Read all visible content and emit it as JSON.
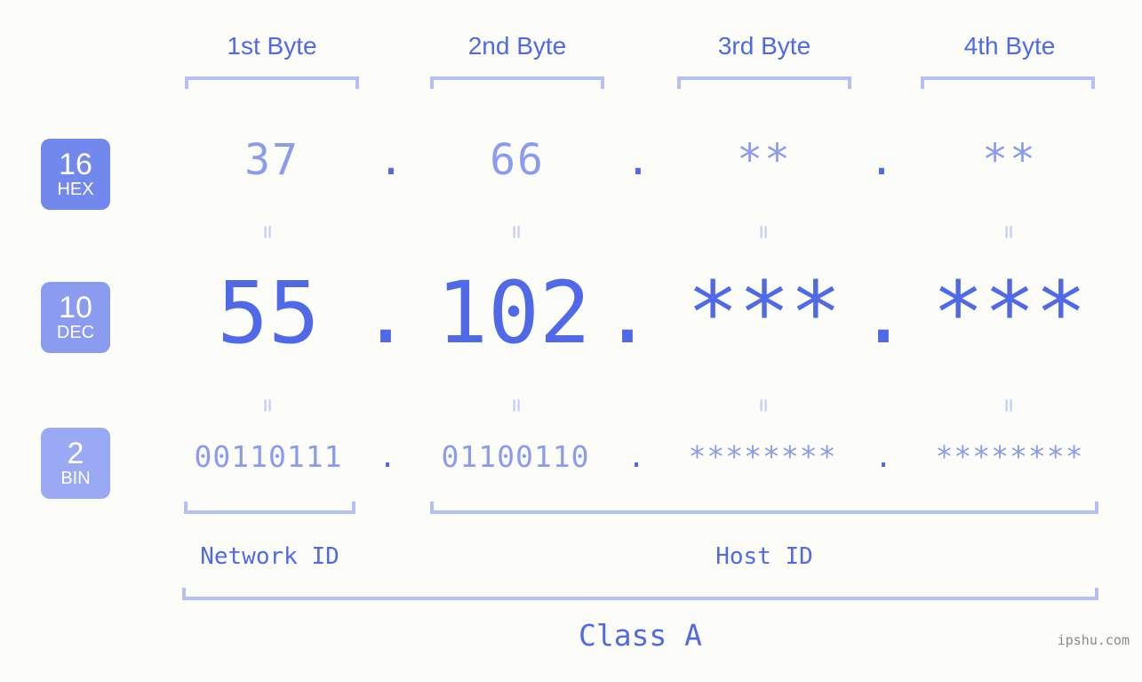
{
  "watermark": "ipshu.com",
  "byte_headers": [
    {
      "label": "1st Byte"
    },
    {
      "label": "2nd Byte"
    },
    {
      "label": "3rd Byte"
    },
    {
      "label": "4th Byte"
    }
  ],
  "bases": [
    {
      "number": "16",
      "name": "HEX",
      "color": "#7388ec"
    },
    {
      "number": "10",
      "name": "DEC",
      "color": "#8b9cf0"
    },
    {
      "number": "2",
      "name": "BIN",
      "color": "#9aa9f4"
    }
  ],
  "rows": {
    "hex": {
      "base_number": "16",
      "base_name": "HEX",
      "values": [
        "37",
        "66",
        "**",
        "**"
      ],
      "separators": [
        ".",
        ".",
        "."
      ]
    },
    "dec": {
      "base_number": "10",
      "base_name": "DEC",
      "values": [
        "55",
        "102",
        "***",
        "***"
      ],
      "separators": [
        ".",
        ".",
        "."
      ]
    },
    "bin": {
      "base_number": "2",
      "base_name": "BIN",
      "values": [
        "00110111",
        "01100110",
        "********",
        "********"
      ],
      "separators": [
        ".",
        ".",
        "."
      ]
    }
  },
  "connectors": {
    "glyph": "=",
    "count_per_row": 4
  },
  "id_sections": [
    {
      "label": "Network ID"
    },
    {
      "label": "Host ID"
    }
  ],
  "class_section": {
    "label": "Class A"
  },
  "colors": {
    "background": "#fcfdf9",
    "accent_strong": "#5069e8",
    "accent_medium": "#8b9cf0",
    "accent_light": "#b6c0f8",
    "badge_hex": "#7388ec",
    "badge_dec": "#8b9cf0",
    "badge_bin": "#9aa9f4",
    "watermark": "#8a8a8a"
  }
}
